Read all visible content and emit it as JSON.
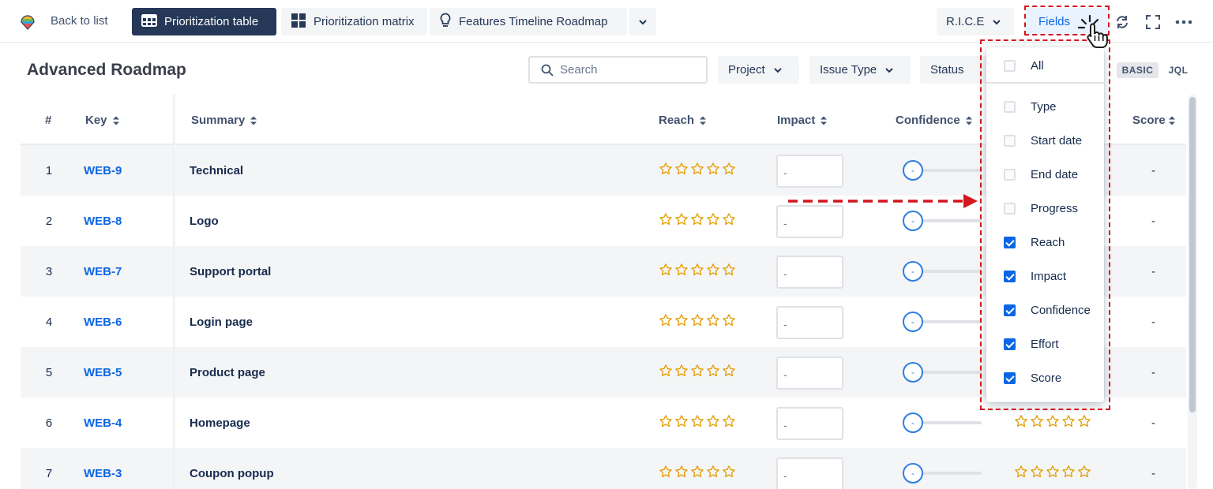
{
  "topbar": {
    "back_label": "Back to list",
    "tabs": [
      {
        "label": "Prioritization table",
        "icon": "table-icon",
        "active": true
      },
      {
        "label": "Prioritization matrix",
        "icon": "matrix-icon",
        "active": false
      },
      {
        "label": "Features Timeline Roadmap",
        "icon": "lightbulb-icon",
        "active": false
      }
    ],
    "framework_label": "R.I.C.E",
    "fields_label": "Fields"
  },
  "toolbar": {
    "title": "Advanced Roadmap",
    "search_placeholder": "Search",
    "filters": [
      "Project",
      "Issue Type",
      "Status"
    ],
    "modes": [
      "BASIC",
      "JQL"
    ]
  },
  "table": {
    "columns": {
      "num": "#",
      "key": "Key",
      "summary": "Summary",
      "reach": "Reach",
      "impact": "Impact",
      "confidence": "Confidence",
      "score": "Score"
    },
    "rows": [
      {
        "num": "1",
        "key": "WEB-9",
        "summary": "Technical",
        "impact": "-",
        "confidence": "-",
        "score": "-"
      },
      {
        "num": "2",
        "key": "WEB-8",
        "summary": "Logo",
        "impact": "-",
        "confidence": "-",
        "score": "-"
      },
      {
        "num": "3",
        "key": "WEB-7",
        "summary": "Support portal",
        "impact": "-",
        "confidence": "-",
        "score": "-"
      },
      {
        "num": "4",
        "key": "WEB-6",
        "summary": "Login page",
        "impact": "-",
        "confidence": "-",
        "score": "-"
      },
      {
        "num": "5",
        "key": "WEB-5",
        "summary": "Product page",
        "impact": "-",
        "confidence": "-",
        "score": "-"
      },
      {
        "num": "6",
        "key": "WEB-4",
        "summary": "Homepage",
        "impact": "-",
        "confidence": "-",
        "score": "-"
      },
      {
        "num": "7",
        "key": "WEB-3",
        "summary": "Coupon popup",
        "impact": "-",
        "confidence": "-",
        "score": "-"
      }
    ]
  },
  "fields_menu": {
    "all_label": "All",
    "items": [
      {
        "label": "Type",
        "checked": false
      },
      {
        "label": "Start date",
        "checked": false
      },
      {
        "label": "End date",
        "checked": false
      },
      {
        "label": "Progress",
        "checked": false
      },
      {
        "label": "Reach",
        "checked": true
      },
      {
        "label": "Impact",
        "checked": true
      },
      {
        "label": "Confidence",
        "checked": true
      },
      {
        "label": "Effort",
        "checked": true
      },
      {
        "label": "Score",
        "checked": true
      }
    ]
  },
  "colors": {
    "accent": "#0c66e4",
    "star": "#e3a008",
    "highlight": "#d4161f",
    "active_tab": "#253858"
  }
}
